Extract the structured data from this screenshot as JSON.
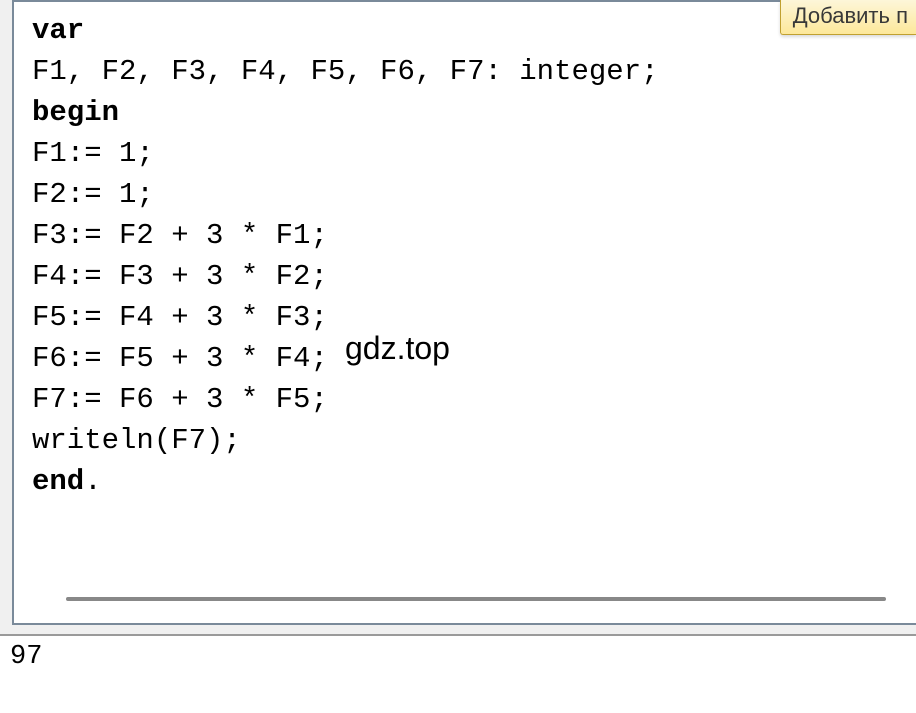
{
  "button": {
    "add_label": "Добавить п"
  },
  "code": {
    "line1_kw": "var",
    "line2": "F1, F2, F3, F4, F5, F6, F7: integer;",
    "line3_kw": "begin",
    "line4": "F1:= 1;",
    "line5": "F2:= 1;",
    "line6": "F3:= F2 + 3 * F1;",
    "line7": "F4:= F3 + 3 * F2;",
    "line8": "F5:= F4 + 3 * F3;",
    "line9": "F6:= F5 + 3 * F4;",
    "line10": "F7:= F6 + 3 * F5;",
    "line11": "writeln(F7);",
    "line12_kw": "end",
    "line12_rest": "."
  },
  "watermark": "gdz.top",
  "output": {
    "result": "97"
  }
}
